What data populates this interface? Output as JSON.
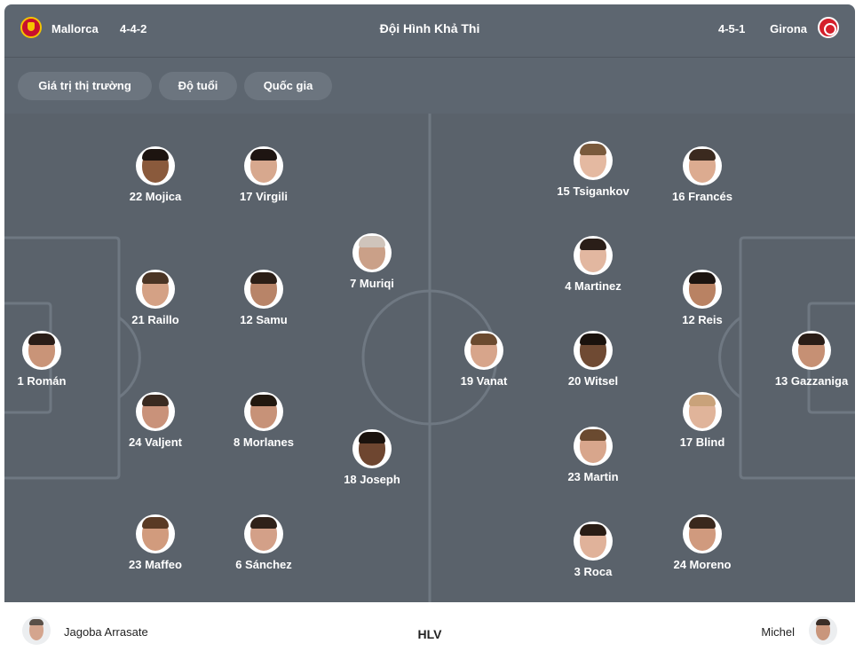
{
  "header": {
    "title": "Đội Hình Khả Thi",
    "home_team": {
      "name": "Mallorca",
      "formation": "4-4-2",
      "logo_icon": "mallorca-crest-icon"
    },
    "away_team": {
      "name": "Girona",
      "formation": "4-5-1",
      "logo_icon": "girona-crest-icon"
    }
  },
  "filters": [
    "Giá trị thị trường",
    "Độ tuổi",
    "Quốc gia"
  ],
  "colors": {
    "panel": "#5d6670",
    "pitch": "#5a626b",
    "chip": "#6c757f",
    "lines": "#6f7882"
  },
  "home_players": [
    {
      "label": "1 Román",
      "skin": "#c99478",
      "hair": "#2a1d17"
    },
    {
      "label": "24 Valjent",
      "skin": "#c9927a",
      "hair": "#3a2a20"
    },
    {
      "label": "21 Raillo",
      "skin": "#d4a185",
      "hair": "#4a3424"
    },
    {
      "label": "22 Mojica",
      "skin": "#8a5a3c",
      "hair": "#1d1410"
    },
    {
      "label": "23 Maffeo",
      "skin": "#d19b7d",
      "hair": "#5a3a24"
    },
    {
      "label": "8 Morlanes",
      "skin": "#c79278",
      "hair": "#22180f"
    },
    {
      "label": "12 Samu",
      "skin": "#b88468",
      "hair": "#2b1e16"
    },
    {
      "label": "17 Virgili",
      "skin": "#d7a88e",
      "hair": "#1e1512"
    },
    {
      "label": "6 Sánchez",
      "skin": "#d3a088",
      "hair": "#2f2119"
    },
    {
      "label": "7 Muriqi",
      "skin": "#caa088",
      "hair": "#cfc4bb"
    },
    {
      "label": "18 Joseph",
      "skin": "#6e4630",
      "hair": "#1a120d"
    }
  ],
  "away_players": [
    {
      "label": "13 Gazzaniga",
      "skin": "#c69074",
      "hair": "#2a1d17"
    },
    {
      "label": "24 Moreno",
      "skin": "#d09a7e",
      "hair": "#3a281d"
    },
    {
      "label": "17 Blind",
      "skin": "#e0b49a",
      "hair": "#c9a27a"
    },
    {
      "label": "12 Reis",
      "skin": "#b98263",
      "hair": "#1c1410"
    },
    {
      "label": "16 Francés",
      "skin": "#dcab90",
      "hair": "#3b2a1f"
    },
    {
      "label": "3 Roca",
      "skin": "#e0b29a",
      "hair": "#2a1d15"
    },
    {
      "label": "23 Martin",
      "skin": "#d8a68c",
      "hair": "#6a4a30"
    },
    {
      "label": "20 Witsel",
      "skin": "#6f4a33",
      "hair": "#1a120d"
    },
    {
      "label": "4 Martinez",
      "skin": "#e2b7a0",
      "hair": "#2a1e18"
    },
    {
      "label": "15 Tsigankov",
      "skin": "#e4b9a1",
      "hair": "#7a5a3c"
    },
    {
      "label": "19 Vanat",
      "skin": "#d7a58b",
      "hair": "#6b4a2f"
    }
  ],
  "coaches": {
    "label": "HLV",
    "home": {
      "name": "Jagoba Arrasate",
      "skin": "#d4a58e",
      "hair": "#5a5048"
    },
    "away": {
      "name": "Michel",
      "skin": "#c9967c",
      "hair": "#3a2e27"
    }
  }
}
